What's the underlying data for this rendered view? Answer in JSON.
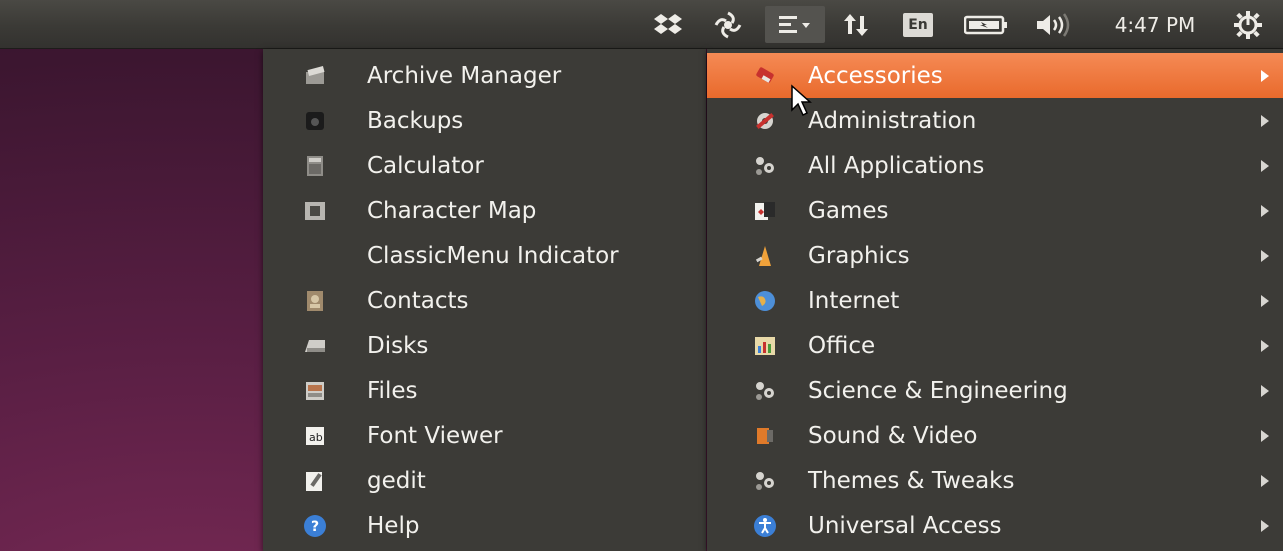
{
  "panel": {
    "indicators": [
      {
        "icon": "dropbox-icon"
      },
      {
        "icon": "keepass-icon"
      },
      {
        "icon": "classicmenu-indicator-icon"
      },
      {
        "icon": "network-transfer-icon"
      },
      {
        "icon": "keyboard-layout-icon",
        "label": "En"
      },
      {
        "icon": "battery-icon"
      },
      {
        "icon": "volume-icon"
      }
    ],
    "clock": "4:47 PM",
    "session_icon": "gear-power-icon"
  },
  "submenu": {
    "items": [
      {
        "label": "Archive Manager",
        "icon": "archive-manager-icon"
      },
      {
        "label": "Backups",
        "icon": "backups-icon"
      },
      {
        "label": "Calculator",
        "icon": "calculator-icon"
      },
      {
        "label": "Character Map",
        "icon": "character-map-icon"
      },
      {
        "label": "ClassicMenu Indicator",
        "icon": "classicmenu-blank-icon"
      },
      {
        "label": "Contacts",
        "icon": "contacts-icon"
      },
      {
        "label": "Disks",
        "icon": "disks-icon"
      },
      {
        "label": "Files",
        "icon": "files-icon"
      },
      {
        "label": "Font Viewer",
        "icon": "font-viewer-icon"
      },
      {
        "label": "gedit",
        "icon": "gedit-icon"
      },
      {
        "label": "Help",
        "icon": "help-icon"
      }
    ]
  },
  "menu": {
    "active_item": "Accessories",
    "items": [
      {
        "label": "Accessories",
        "icon": "accessories-icon"
      },
      {
        "label": "Administration",
        "icon": "administration-icon"
      },
      {
        "label": "All Applications",
        "icon": "gears-icon"
      },
      {
        "label": "Games",
        "icon": "games-icon"
      },
      {
        "label": "Graphics",
        "icon": "graphics-icon"
      },
      {
        "label": "Internet",
        "icon": "internet-globe-icon"
      },
      {
        "label": "Office",
        "icon": "office-icon"
      },
      {
        "label": "Science & Engineering",
        "icon": "gears-icon"
      },
      {
        "label": "Sound & Video",
        "icon": "sound-video-icon"
      },
      {
        "label": "Themes & Tweaks",
        "icon": "gears-icon"
      },
      {
        "label": "Universal Access",
        "icon": "universal-access-icon"
      }
    ]
  },
  "colors": {
    "highlight": "#e96a2c",
    "menu_bg": "#3c3b37",
    "panel_bg": "#3b3a36",
    "wallpaper": "#5a1f44"
  }
}
